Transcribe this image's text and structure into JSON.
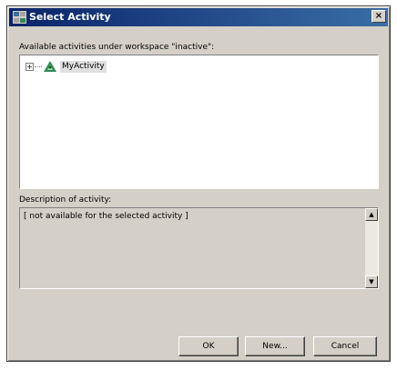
{
  "window": {
    "title": "Select Activity",
    "close_glyph": "×"
  },
  "activities": {
    "label": "Available activities under workspace \"inactive\":",
    "tree": [
      {
        "expander": "+",
        "icon": "activity-icon",
        "label": "MyActivity",
        "selected": true
      }
    ]
  },
  "description": {
    "label": "Description of activity:",
    "text": "[ not available for the selected activity ]",
    "scroll_up": "▲",
    "scroll_down": "▼"
  },
  "buttons": {
    "ok": "OK",
    "new": "New...",
    "cancel": "Cancel"
  },
  "colors": {
    "title_start": "#0a246a",
    "title_end": "#3a6ea5",
    "dialog_bg": "#d4d0c8",
    "icon_green": "#2e8b57"
  }
}
